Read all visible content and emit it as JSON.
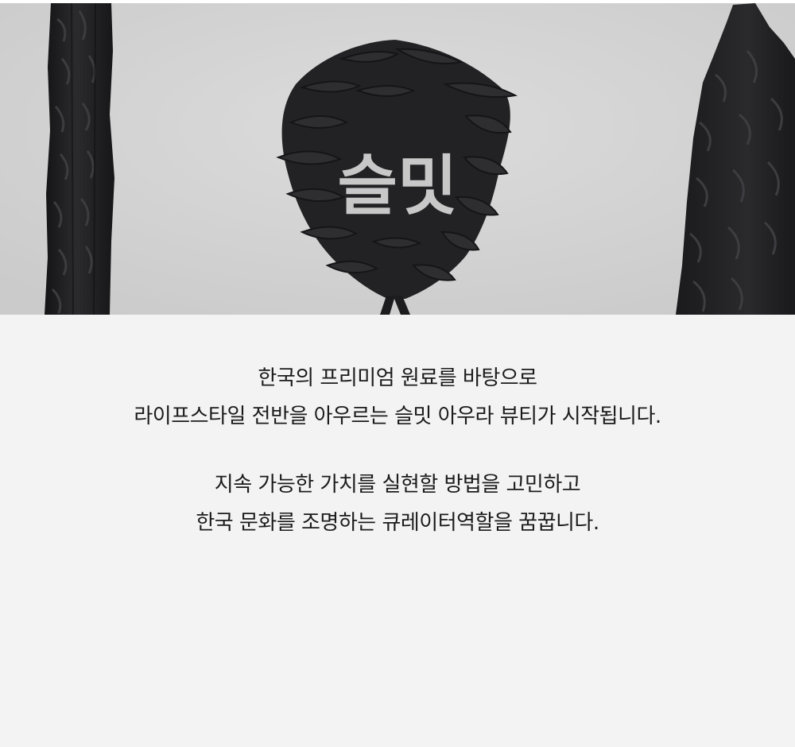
{
  "hero": {
    "logo_text": "슬밋",
    "colors": {
      "sky": "#d3d3d3",
      "bark": "#1f1f21",
      "cone": "#232325",
      "logo": "#c8c8c8"
    }
  },
  "intro": {
    "paragraph1": {
      "line1": "한국의 프리미엄 원료를 바탕으로",
      "line2": "라이프스타일 전반을 아우르는 슬밋 아우라 뷰티가 시작됩니다."
    },
    "paragraph2": {
      "line1": "지속 가능한 가치를 실현할 방법을 고민하고",
      "line2": "한국 문화를 조명하는 큐레이터역할을 꿈꿉니다."
    }
  },
  "colors": {
    "background": "#f3f3f3",
    "text": "#1b1b1b"
  }
}
